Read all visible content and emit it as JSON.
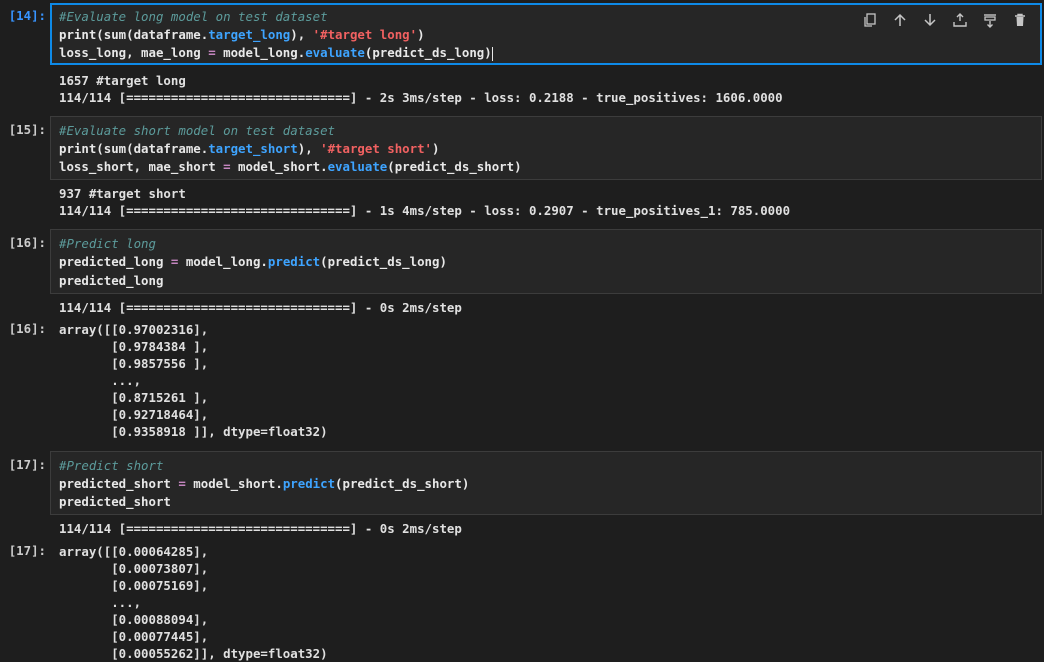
{
  "colors": {
    "background": "#1e1e1e",
    "cell_background": "#262626",
    "selected_border": "#0e8ae8",
    "comment": "#5c9b9b",
    "function": "#3ea4ff",
    "string": "#f16161",
    "operator": "#c586c0"
  },
  "toolbar": {
    "icons": [
      "copy-icon",
      "move-up-icon",
      "move-down-icon",
      "insert-above-icon",
      "insert-below-icon",
      "delete-icon"
    ]
  },
  "cells": [
    {
      "prompt": "[14]:",
      "code": {
        "l1": "#Evaluate long model on test dataset",
        "l2_a": "print(sum(dataframe.",
        "l2_b": "target_long",
        "l2_c": "), ",
        "l2_d": "'#target long'",
        "l2_e": ")",
        "l3_a": "loss_long, mae_long ",
        "l3_b": "=",
        "l3_c": " model_long.",
        "l3_d": "evaluate",
        "l3_e": "(predict_ds_long)"
      },
      "output": [
        "1657 #target long",
        "114/114 [==============================] - 2s 3ms/step - loss: 0.2188 - true_positives: 1606.0000"
      ]
    },
    {
      "prompt": "[15]:",
      "code": {
        "l1": "#Evaluate short model on test dataset",
        "l2_a": "print(sum(dataframe.",
        "l2_b": "target_short",
        "l2_c": "), ",
        "l2_d": "'#target short'",
        "l2_e": ")",
        "l3_a": "loss_short, mae_short ",
        "l3_b": "=",
        "l3_c": " model_short.",
        "l3_d": "evaluate",
        "l3_e": "(predict_ds_short)"
      },
      "output": [
        "937 #target short",
        "114/114 [==============================] - 1s 4ms/step - loss: 0.2907 - true_positives_1: 785.0000"
      ]
    },
    {
      "prompt": "[16]:",
      "code": {
        "l1": "#Predict long",
        "l2_a": "predicted_long ",
        "l2_b": "=",
        "l2_c": " model_long.",
        "l2_d": "predict",
        "l2_e": "(predict_ds_long)",
        "l3": "predicted_long"
      },
      "stream": "114/114 [==============================] - 0s 2ms/step",
      "result_prompt": "[16]:",
      "result": [
        "array([[0.97002316],",
        "       [0.9784384 ],",
        "       [0.9857556 ],",
        "       ...,",
        "       [0.8715261 ],",
        "       [0.92718464],",
        "       [0.9358918 ]], dtype=float32)"
      ]
    },
    {
      "prompt": "[17]:",
      "code": {
        "l1": "#Predict short",
        "l2_a": "predicted_short ",
        "l2_b": "=",
        "l2_c": " model_short.",
        "l2_d": "predict",
        "l2_e": "(predict_ds_short)",
        "l3": "predicted_short"
      },
      "stream": "114/114 [==============================] - 0s 2ms/step",
      "result_prompt": "[17]:",
      "result": [
        "array([[0.00064285],",
        "       [0.00073807],",
        "       [0.00075169],",
        "       ...,",
        "       [0.00088094],",
        "       [0.00077445],",
        "       [0.00055262]], dtype=float32)"
      ]
    }
  ]
}
